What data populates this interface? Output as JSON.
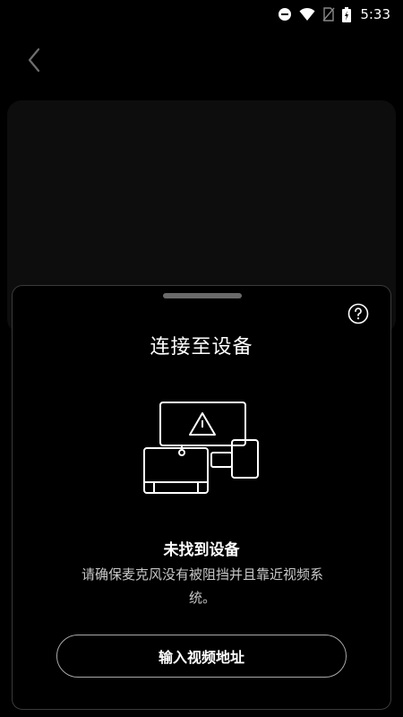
{
  "status_bar": {
    "time": "5:33",
    "icons": [
      "do-not-disturb-icon",
      "wifi-icon",
      "no-sim-icon",
      "battery-charging-icon"
    ]
  },
  "nav": {
    "back_icon": "chevron-left-icon"
  },
  "sheet": {
    "title": "连接至设备",
    "help_icon": "question-circle-icon",
    "illustration_icon": "devices-warning-icon",
    "empty_state": {
      "title": "未找到设备",
      "description": "请确保麦克风没有被阻挡并且靠近视频系统。"
    },
    "enter_url_button": "输入视频地址"
  },
  "colors": {
    "background": "#000000",
    "sheet_border": "#3a3a3a",
    "text_primary": "#ffffff",
    "text_secondary": "#c8c8c8"
  }
}
